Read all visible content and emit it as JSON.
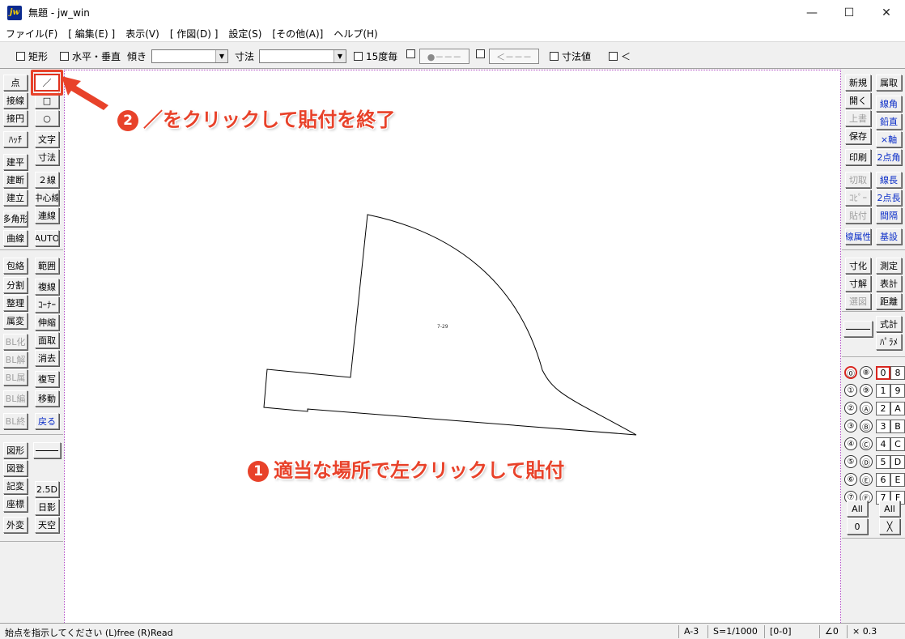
{
  "window": {
    "title": "無題 - jw_win",
    "app_icon": "jw",
    "minimize": "—",
    "maximize": "☐",
    "close": "✕"
  },
  "menu": [
    "ファイル(F)",
    "[ 編集(E) ]",
    "表示(V)",
    "[ 作図(D) ]",
    "設定(S)",
    "[その他(A)]",
    "ヘルプ(H)"
  ],
  "toolbar": {
    "rect": "矩形",
    "hv": "水平・垂直",
    "slope": "傾き",
    "dim": "寸法",
    "deg15": "15度毎",
    "btn_circle": "●－－－",
    "btn_arrow": "＜－－－",
    "dimval": "寸法値",
    "lt": "＜"
  },
  "left_panel": {
    "col1": [
      "点",
      "接線",
      "接円",
      "ﾊｯﾁ",
      "建平",
      "建断",
      "建立",
      "多角形",
      "曲線",
      "包絡",
      "分割",
      "整理",
      "属変",
      "BL化",
      "BL解",
      "BL属",
      "BL編",
      "BL終",
      "図形",
      "図登",
      "記変",
      "座標",
      "外変"
    ],
    "col2": [
      "文字",
      "寸法",
      "２線",
      "中心線",
      "連線",
      "AUTO",
      "範囲",
      "複線",
      "ｺｰﾅｰ",
      "伸縮",
      "面取",
      "消去",
      "複写",
      "移動",
      "戻る",
      "2.5D",
      "日影",
      "天空"
    ],
    "tool_line": "／",
    "tool_rect": "□",
    "tool_circle": "○"
  },
  "right_panel": {
    "col1": [
      "新規",
      "開く",
      "上書",
      "保存",
      "印刷",
      "切取",
      "ｺﾋﾟｰ",
      "貼付",
      "線属性",
      "寸化",
      "寸解",
      "選図"
    ],
    "col2": [
      "属取",
      "線角",
      "鉛直",
      "×軸",
      "2点角",
      "線長",
      "2点長",
      "間隔",
      "基設",
      "測定",
      "表計",
      "距離",
      "式計",
      "ﾊﾟﾗﾒ"
    ],
    "pen_layers": [
      "⓪",
      "①",
      "②",
      "③",
      "④",
      "⑤",
      "⑥",
      "⑦"
    ],
    "pen_layers2": [
      "⑧",
      "⑨",
      "Ⓐ",
      "Ⓑ",
      "Ⓒ",
      "Ⓓ",
      "Ⓔ",
      "Ⓕ"
    ],
    "groups": [
      "0",
      "1",
      "2",
      "3",
      "4",
      "5",
      "6",
      "7"
    ],
    "groups2": [
      "8",
      "9",
      "A",
      "B",
      "C",
      "D",
      "E",
      "F"
    ],
    "all1": "All",
    "all2": "All",
    "zero": "0",
    "x": "╳"
  },
  "canvas": {
    "label": "7-29"
  },
  "annotations": {
    "step1_num": "1",
    "step1": "適当な場所で左クリックして貼付",
    "step2_num": "2",
    "step2": "／をクリックして貼付を終了"
  },
  "status": {
    "message": "始点を指示してください (L)free (R)Read",
    "paper": "A-3",
    "scale": "S=1/1000",
    "layer": "[0-0]",
    "angle": "∠0",
    "zoom": "× 0.3"
  },
  "colors": {
    "annotation": "#e8422a",
    "canvas_border": "#b04cc4",
    "blue_text": "#0a2dc8"
  }
}
